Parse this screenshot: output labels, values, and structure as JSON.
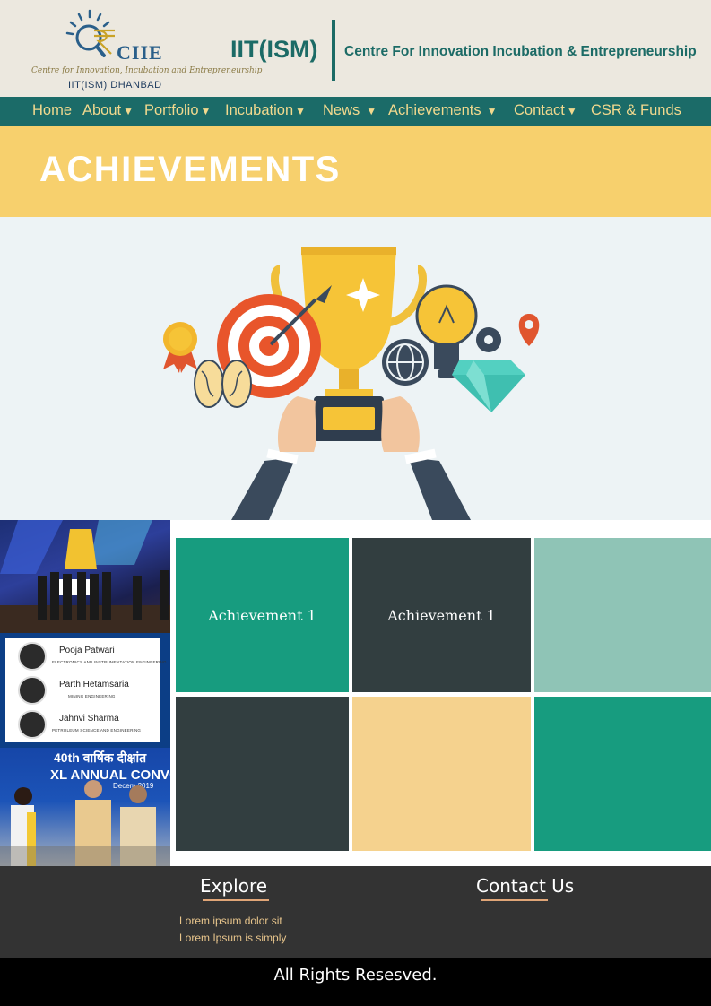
{
  "header": {
    "logo_name": "CIIE",
    "logo_tagline": "Centre for Innovation, Incubation and Entrepreneurship",
    "logo_sub": "IIT(ISM) DHANBAD",
    "institute": "IIT(ISM)",
    "centre": "Centre For Innovation Incubation & Entrepreneurship"
  },
  "nav": {
    "items": [
      {
        "label": "Home",
        "caret": ""
      },
      {
        "label": "About",
        "caret": "▼"
      },
      {
        "label": "Portfolio",
        "caret": "▼"
      },
      {
        "label": "Incubation",
        "caret": "▼"
      },
      {
        "label": "News",
        "caret": "▼"
      },
      {
        "label": "Achievements",
        "caret": "▼"
      },
      {
        "label": "Contact",
        "caret": "▼"
      },
      {
        "label": "CSR & Funds",
        "caret": ""
      }
    ]
  },
  "banner": {
    "title": "ACHIEVEMENTS"
  },
  "collage": {
    "people": [
      {
        "name": "Pooja Patwari",
        "dept": "ELECTRONICS AND INSTRUMENTATION ENGINEERING"
      },
      {
        "name": "Parth Hetamsaria",
        "dept": "MINING ENGINEERING"
      },
      {
        "name": "Jahnvi Sharma",
        "dept": "PETROLEUM SCIENCE AND ENGINEERING"
      }
    ],
    "convocation_line1": "40th वार्षिक दीक्षांत",
    "convocation_line2": "XL ANNUAL CONVO",
    "convocation_line3": "Decem 2019"
  },
  "grid": {
    "tiles": [
      {
        "label": "Achievement 1",
        "color": "#179c7f"
      },
      {
        "label": "Achievement 1",
        "color": "#323e40"
      },
      {
        "label": "",
        "color": "#8fc4b6"
      },
      {
        "label": "",
        "color": "#323e40"
      },
      {
        "label": "",
        "color": "#f5d28e"
      },
      {
        "label": "",
        "color": "#179c7f"
      }
    ]
  },
  "footer": {
    "explore_heading": "Explore",
    "explore_links": [
      "Lorem ipsum dolor sit",
      "Lorem Ipsum is simply"
    ],
    "contact_heading": "Contact Us",
    "copyright": "All Rights Resesved."
  },
  "colors": {
    "header_bg": "#ece8df",
    "nav_bg": "#1b6b68",
    "nav_text": "#f1d98e",
    "banner_bg": "#f7d06d",
    "footer_bg": "#333333",
    "brand_teal": "#1c6b66"
  }
}
